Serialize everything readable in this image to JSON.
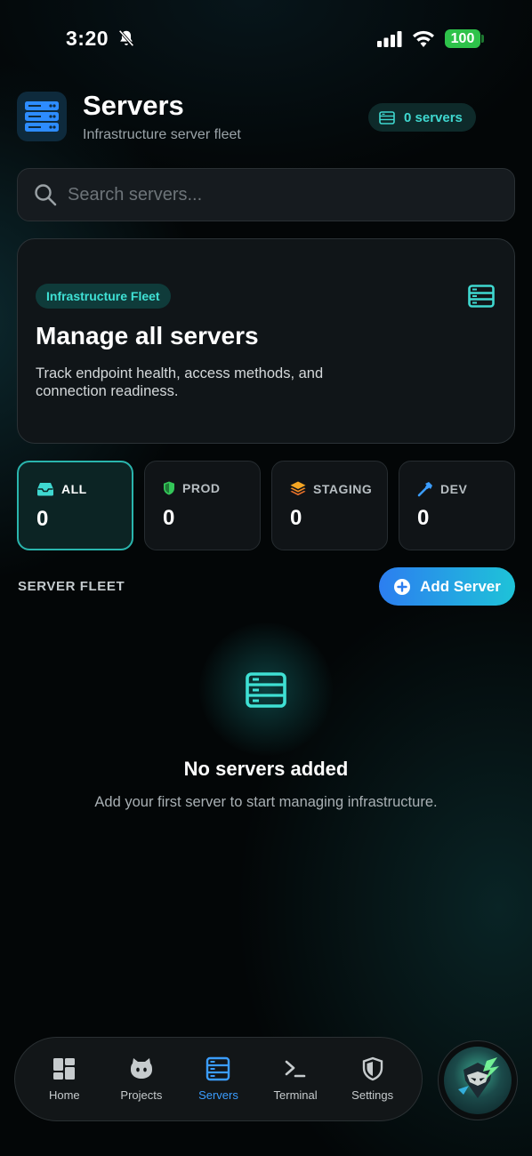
{
  "status_bar": {
    "time": "3:20",
    "battery": "100"
  },
  "header": {
    "title": "Servers",
    "subtitle": "Infrastructure server fleet",
    "badge": "0 servers"
  },
  "search": {
    "placeholder": "Search servers..."
  },
  "hero": {
    "pill": "Infrastructure Fleet",
    "title": "Manage all servers",
    "description": "Track endpoint health, access methods, and connection readiness."
  },
  "filters": [
    {
      "label": "ALL",
      "count": "0",
      "icon": "inbox-icon"
    },
    {
      "label": "PROD",
      "count": "0",
      "icon": "shield-icon"
    },
    {
      "label": "STAGING",
      "count": "0",
      "icon": "layers-icon"
    },
    {
      "label": "DEV",
      "count": "0",
      "icon": "hammer-icon"
    }
  ],
  "section": {
    "label": "SERVER FLEET",
    "add_button": "Add Server"
  },
  "empty_state": {
    "title": "No servers added",
    "description": "Add your first server to start managing infrastructure."
  },
  "nav": {
    "items": [
      {
        "label": "Home",
        "icon": "dashboard-icon"
      },
      {
        "label": "Projects",
        "icon": "github-cat-icon"
      },
      {
        "label": "Servers",
        "icon": "server-icon"
      },
      {
        "label": "Terminal",
        "icon": "terminal-icon"
      },
      {
        "label": "Settings",
        "icon": "shield-icon"
      }
    ],
    "active": "Servers"
  },
  "colors": {
    "accent": "#3fd8d0",
    "active_nav": "#3b9dff",
    "battery": "#2ec24a",
    "button_start": "#2c7ef0",
    "button_end": "#1ec3d8"
  }
}
